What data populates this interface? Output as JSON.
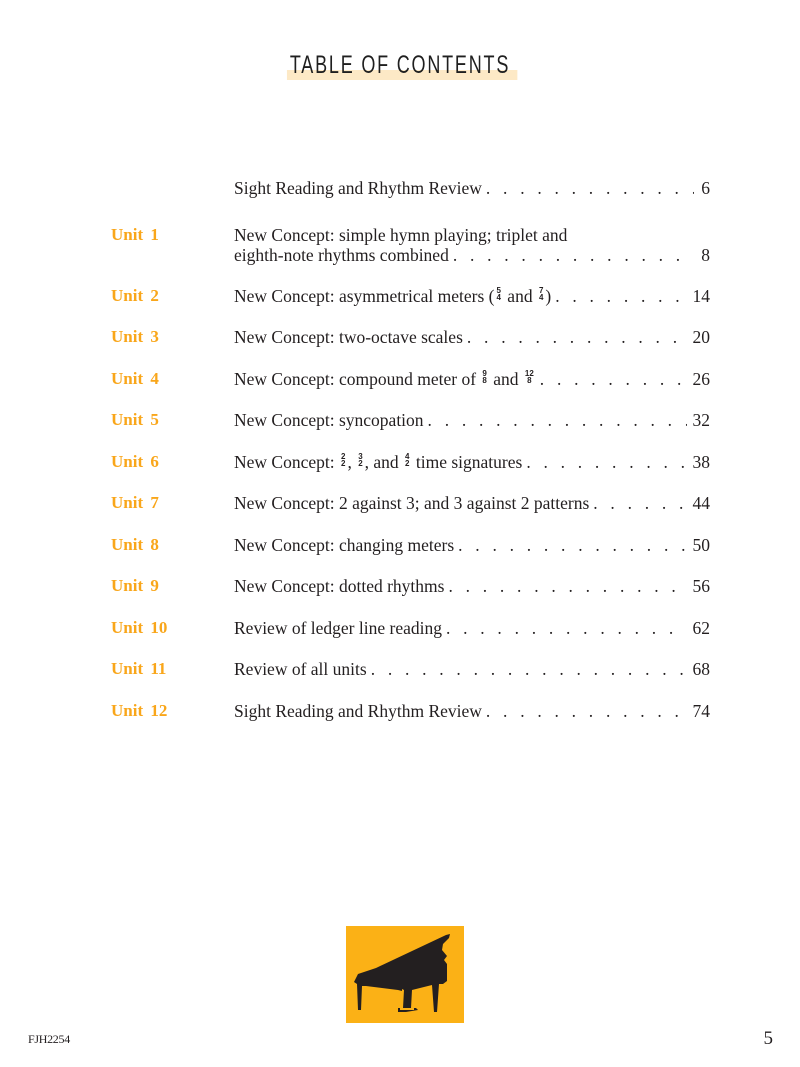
{
  "header": {
    "title": "TABLE OF CONTENTS"
  },
  "toc": {
    "entries": [
      {
        "unit": "",
        "text": "Sight Reading and Rhythm Review",
        "page": "6"
      },
      {
        "unit": "Unit 1",
        "text_line1": "New Concept: simple hymn playing; triplet and",
        "text": "eighth-note rhythms combined",
        "page": "8"
      },
      {
        "unit": "Unit 2",
        "text_pre": "New Concept: asymmetrical meters (",
        "frac1": {
          "num": "5",
          "den": "4"
        },
        "text_mid": " and ",
        "frac2": {
          "num": "7",
          "den": "4"
        },
        "text_post": ")",
        "page": "14"
      },
      {
        "unit": "Unit 3",
        "text": "New Concept: two-octave scales",
        "page": "20"
      },
      {
        "unit": "Unit 4",
        "text_pre": "New Concept: compound meter of ",
        "frac1": {
          "num": "9",
          "den": "8"
        },
        "text_mid": " and ",
        "frac2": {
          "num": "12",
          "den": "8"
        },
        "page": "26"
      },
      {
        "unit": "Unit 5",
        "text": "New Concept: syncopation",
        "page": "32"
      },
      {
        "unit": "Unit 6",
        "text_pre": "New Concept: ",
        "frac1": {
          "num": "2",
          "den": "2"
        },
        "text_mid": ", ",
        "frac2": {
          "num": "3",
          "den": "2"
        },
        "text_mid2": ", and ",
        "frac3": {
          "num": "4",
          "den": "2"
        },
        "text_post": " time signatures",
        "page": "38"
      },
      {
        "unit": "Unit 7",
        "text": "New Concept: 2 against 3; and 3 against 2 patterns",
        "page": "44"
      },
      {
        "unit": "Unit 8",
        "text": "New Concept: changing meters",
        "page": "50"
      },
      {
        "unit": "Unit 9",
        "text": "New Concept: dotted rhythms",
        "page": "56"
      },
      {
        "unit": "Unit 10",
        "text": "Review of ledger line reading",
        "page": "62"
      },
      {
        "unit": "Unit 11",
        "text": "Review of all units",
        "page": "68"
      },
      {
        "unit": "Unit 12",
        "text": "Sight Reading and Rhythm Review",
        "page": "74"
      }
    ],
    "leader": ". . . . . . . . . . . . . . . . . . . . . . . . . . . . . . . . . . . . . . . . . . . . . . . . . . . . ."
  },
  "illustration": {
    "icon": "grand-piano-icon",
    "background_color": "#fbb116"
  },
  "footer": {
    "code": "FJH2254",
    "page_number": "5"
  },
  "colors": {
    "unit_label": "#f9a61a",
    "title_highlight": "#fde9c6",
    "text": "#231f20"
  }
}
